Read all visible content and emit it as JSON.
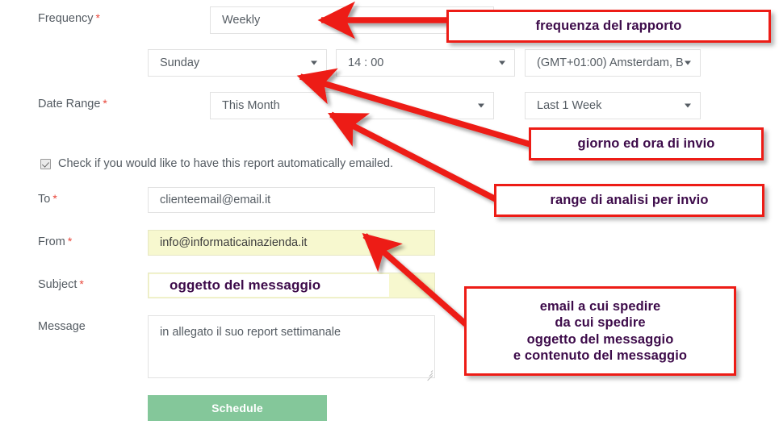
{
  "form": {
    "fields": [
      {
        "key": "frequency",
        "label": "Frequency",
        "required": true,
        "value": "Weekly"
      },
      {
        "key": "day",
        "label": "",
        "required": false,
        "value": "Sunday"
      },
      {
        "key": "time",
        "label": "",
        "required": false,
        "value": "14 : 00"
      },
      {
        "key": "timezone",
        "label": "",
        "required": false,
        "value": "(GMT+01:00) Amsterdam, B"
      },
      {
        "key": "date_range",
        "label": "Date Range",
        "required": true,
        "value": "This Month"
      },
      {
        "key": "period",
        "label": "",
        "required": false,
        "value": "Last 1 Week"
      },
      {
        "key": "to",
        "label": "To",
        "required": true,
        "value": "clienteemail@email.it"
      },
      {
        "key": "from",
        "label": "From",
        "required": true,
        "value": "info@informaticainazienda.it"
      },
      {
        "key": "subject",
        "label": "Subject",
        "required": true,
        "value": ""
      },
      {
        "key": "message",
        "label": "Message",
        "required": false,
        "value": "in allegato il suo report settimanale"
      }
    ],
    "checkbox": {
      "label": "Check if you would like to have this report automatically emailed.",
      "checked": true
    },
    "submit_label": "Schedule",
    "required_marker": "*"
  },
  "annotations": {
    "accent_color": "#ed1c16",
    "text_color": "#3d0b4a",
    "callouts": [
      {
        "id": "frequency-note",
        "text": "frequenza del rapporto"
      },
      {
        "id": "schedule-note",
        "text": "giorno ed ora di invio"
      },
      {
        "id": "range-note",
        "text": "range di analisi per invio"
      },
      {
        "id": "email-note",
        "text": "email a cui spedire\nda cui spedire\noggetto del messaggio\ne contenuto del messaggio"
      }
    ],
    "inline_notes": [
      {
        "id": "subject-note",
        "text": "oggetto del messaggio"
      }
    ]
  }
}
